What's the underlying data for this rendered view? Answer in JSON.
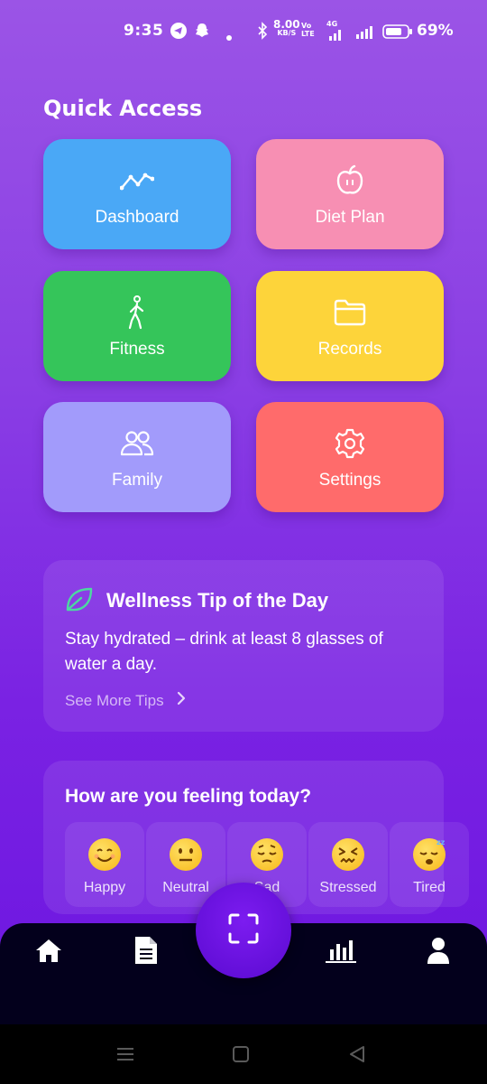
{
  "status_bar": {
    "time": "9:35",
    "speed_value": "8.00",
    "speed_unit": "KB/S",
    "volte_top": "Vo",
    "volte_bottom": "LTE",
    "network": "4G",
    "battery": "69%"
  },
  "quick_access": {
    "title": "Quick Access",
    "tiles": [
      {
        "label": "Dashboard",
        "icon": "chart-line-icon",
        "color": "#4aa8f6"
      },
      {
        "label": "Diet Plan",
        "icon": "apple-icon",
        "color": "#f78fb3"
      },
      {
        "label": "Fitness",
        "icon": "walking-icon",
        "color": "#35c55a"
      },
      {
        "label": "Records",
        "icon": "folder-icon",
        "color": "#fdd43a"
      },
      {
        "label": "Family",
        "icon": "people-icon",
        "color": "#a29bfb"
      },
      {
        "label": "Settings",
        "icon": "gear-icon",
        "color": "#ff6b6b"
      }
    ]
  },
  "wellness_tip": {
    "title": "Wellness Tip of the Day",
    "body": "Stay hydrated – drink at least 8 glasses of water a day.",
    "link": "See More Tips",
    "icon": "leaf-icon",
    "accent": "#4cd9a0"
  },
  "mood": {
    "title": "How are you feeling today?",
    "options": [
      {
        "label": "Happy",
        "icon": "smiling-face-icon"
      },
      {
        "label": "Neutral",
        "icon": "neutral-face-icon"
      },
      {
        "label": "Sad",
        "icon": "pensive-face-icon"
      },
      {
        "label": "Stressed",
        "icon": "confounded-face-icon"
      },
      {
        "label": "Tired",
        "icon": "sleeping-face-icon"
      }
    ]
  },
  "bottom_nav": {
    "items": [
      "home-icon",
      "document-icon",
      "scan-icon",
      "bar-chart-icon",
      "profile-icon"
    ]
  },
  "colors": {
    "background_top": "#9b54e6",
    "background_bottom": "#6a14e0",
    "nav_background": "#03001c",
    "scan_button": "#6a10e0"
  }
}
